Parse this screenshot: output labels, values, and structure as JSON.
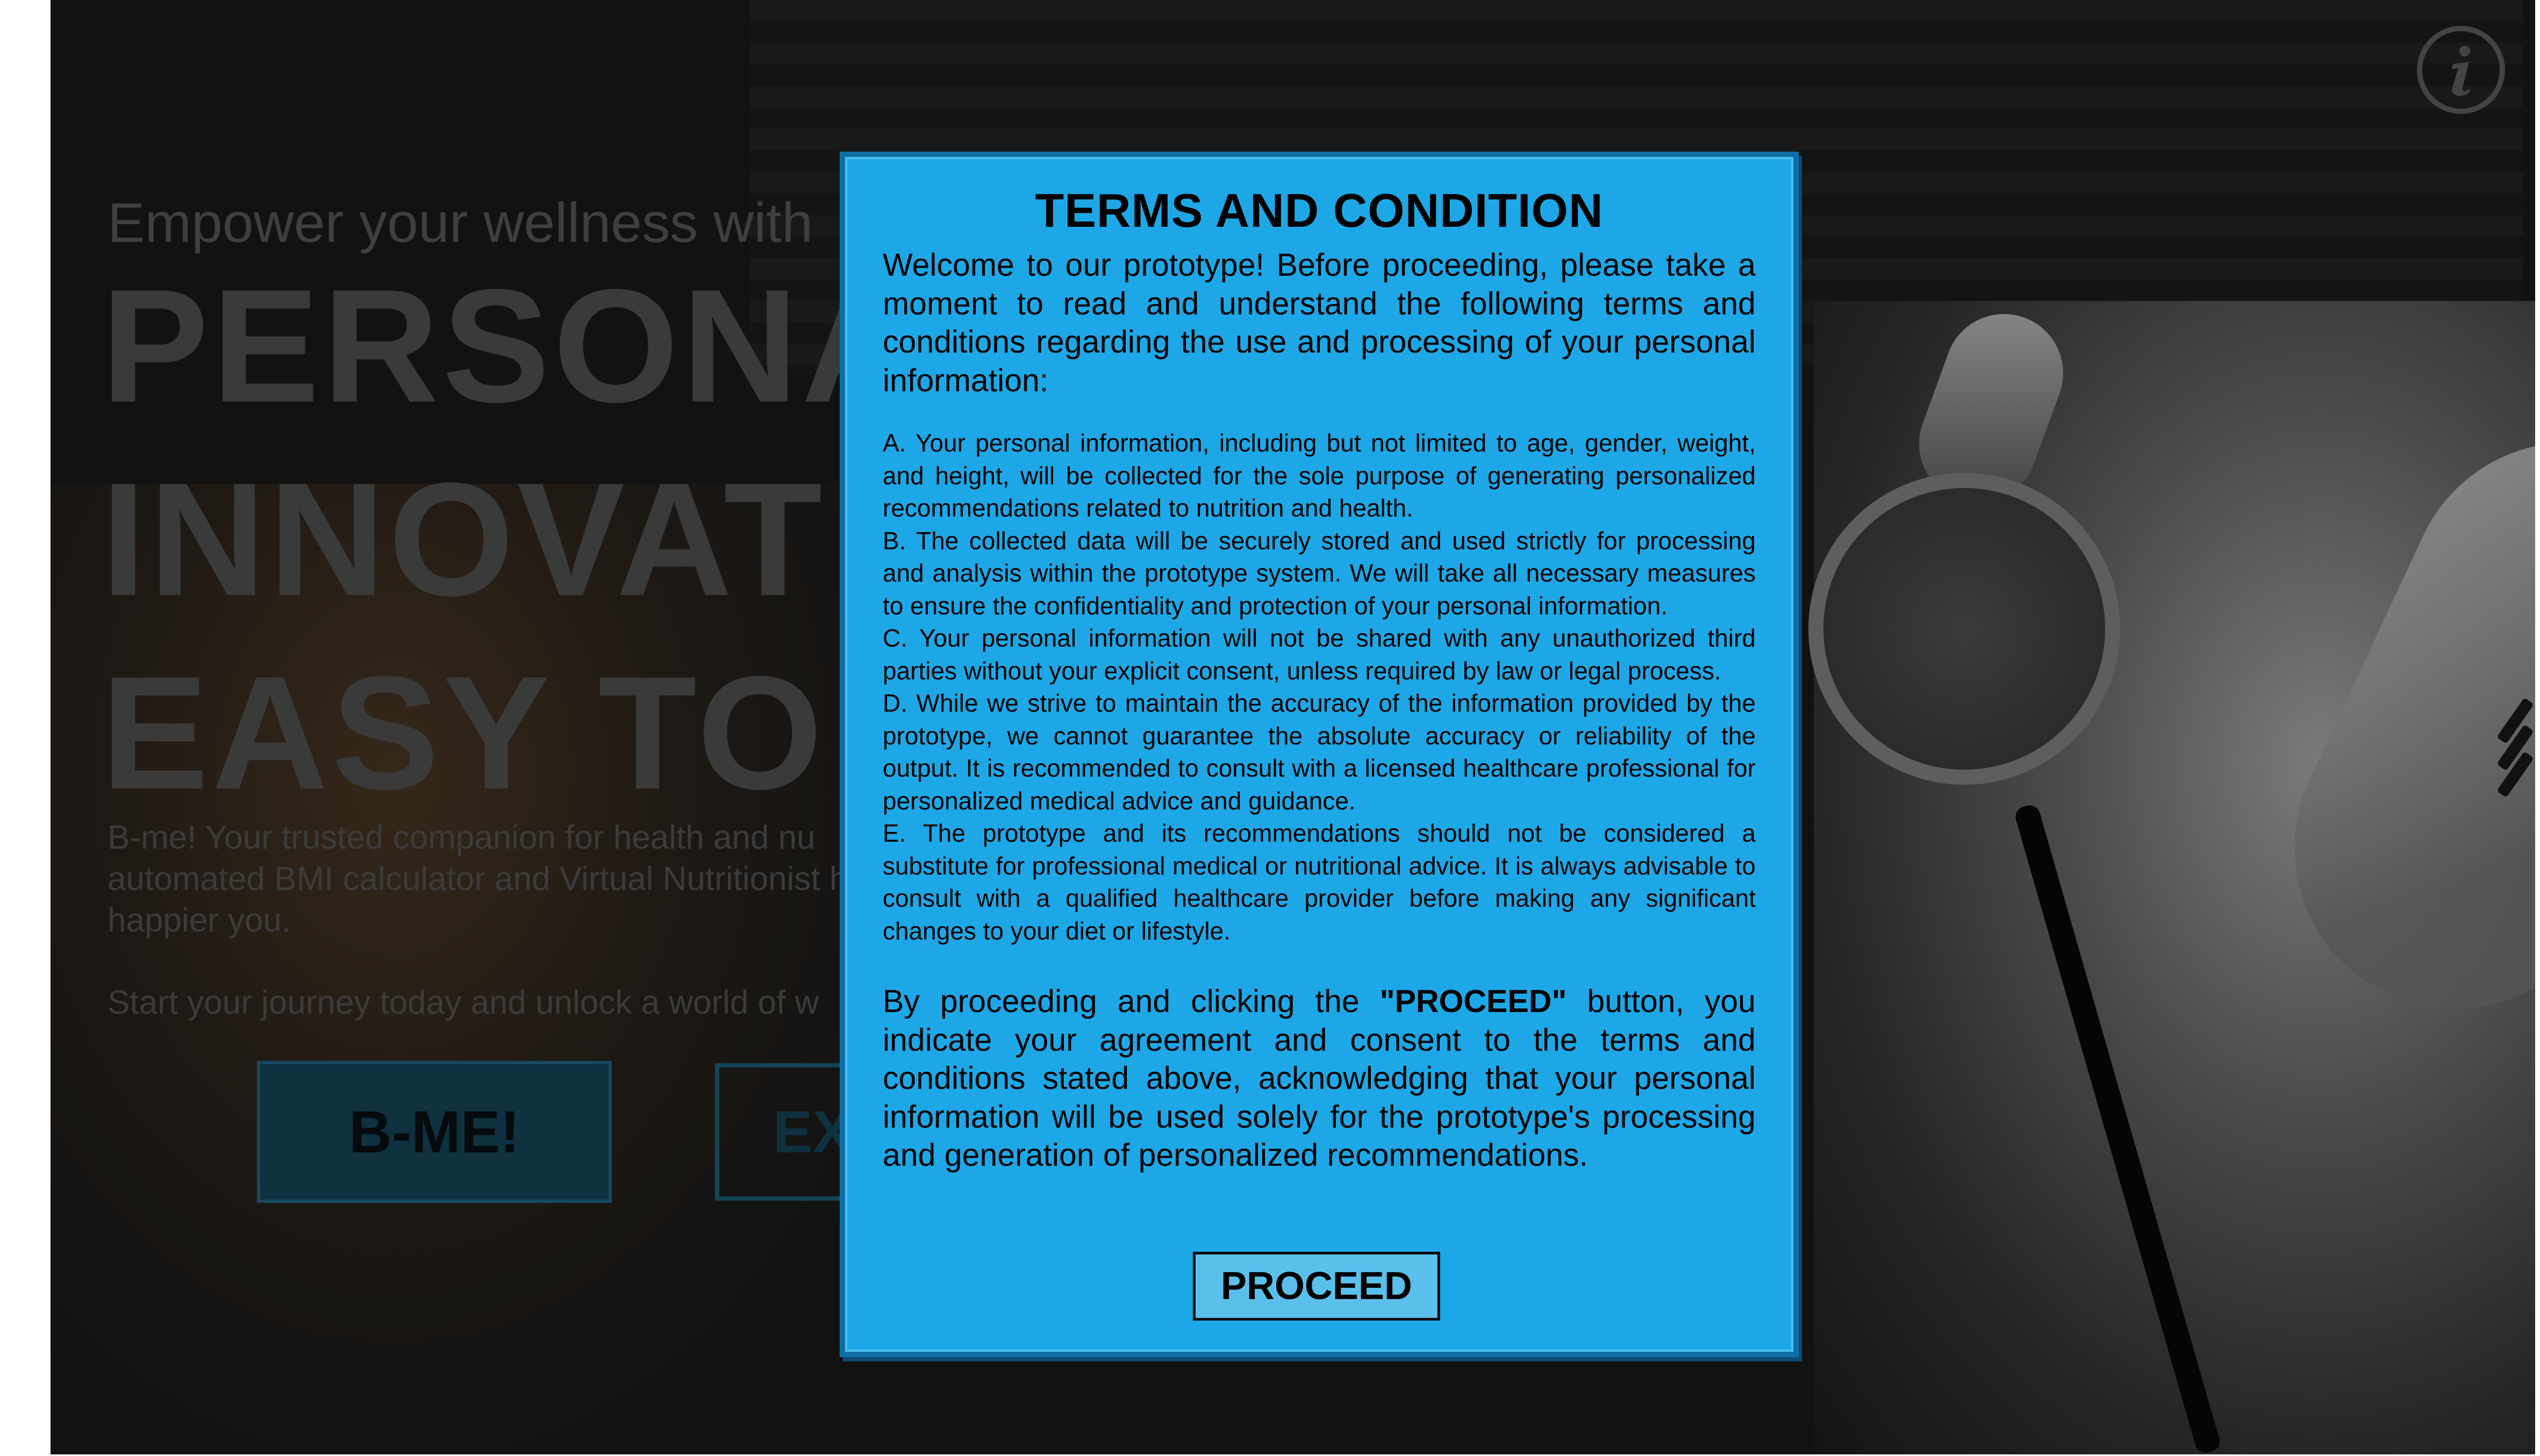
{
  "hero": {
    "subtitle": "Empower your wellness with",
    "headline_lines": [
      "PERSONA",
      "INNOVAT",
      "EASY TO"
    ],
    "description": "B-me! Your trusted companion for health and nu automated BMI calculator and Virtual Nutritionist healthier, happier you.",
    "journey": "Start your journey today and unlock a world of w",
    "bme_button": "B-ME!",
    "explore_button": "EX"
  },
  "info_icon": "info-icon",
  "modal": {
    "title": "TERMS AND CONDITION",
    "intro": "Welcome to our prototype! Before proceeding, please take a moment to read and understand the following terms and conditions regarding the use and processing of your personal information:",
    "clauses": [
      "A. Your personal information, including but not limited to age, gender, weight, and height, will be collected for the sole purpose of generating personalized recommendations related to nutrition and health.",
      "B. The collected data will be securely stored and used strictly for processing and analysis within the prototype system. We will take all necessary measures to ensure the confidentiality and protection of your personal information.",
      "C. Your personal information will not be shared with any unauthorized third parties without your explicit consent, unless required by law or legal process.",
      "D. While we strive to maintain the accuracy of the information provided by the prototype, we cannot guarantee the absolute accuracy or reliability of the output. It is recommended to consult with a licensed healthcare professional for personalized medical advice and guidance.",
      "E. The prototype and its recommendations should not be considered a substitute for professional medical or nutritional advice. It is always advisable to consult with a qualified healthcare provider before making any significant changes to your diet or lifestyle."
    ],
    "agreement_before": "By proceeding and clicking the ",
    "agreement_bold": "\"PROCEED\"",
    "agreement_after": " button, you indicate your agreement and consent to the terms and conditions stated above, acknowledging that your personal information will be used solely for the prototype's processing and generation of personalized recommendations.",
    "proceed_button": "PROCEED"
  },
  "colors": {
    "modal_bg": "#1ea7e6",
    "modal_border": "#0f6ea6",
    "proceed_bg": "#5bbfec",
    "overlay": "#121212"
  }
}
